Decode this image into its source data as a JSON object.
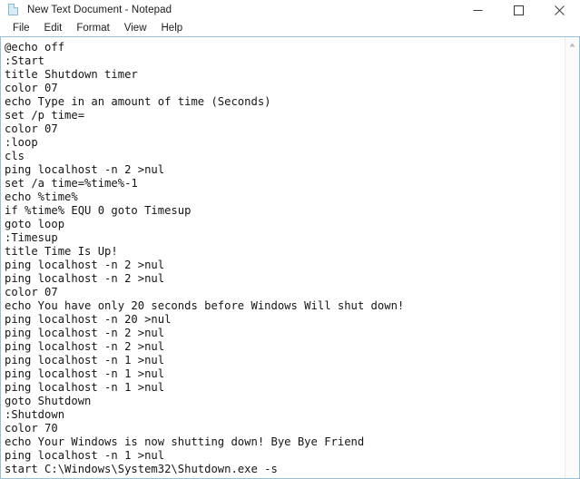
{
  "window": {
    "title": "New Text Document - Notepad",
    "icon": "notepad-document-icon",
    "border_color": "#9bbfd0",
    "titlebar_bg": "#ffffff",
    "text_color": "#151515"
  },
  "window_controls": {
    "minimize": "minimize-icon",
    "maximize": "maximize-icon",
    "close": "close-icon"
  },
  "menubar": {
    "items": [
      {
        "label": "File"
      },
      {
        "label": "Edit"
      },
      {
        "label": "Format"
      },
      {
        "label": "View"
      },
      {
        "label": "Help"
      }
    ]
  },
  "editor": {
    "lines": [
      "@echo off",
      ":Start",
      "title Shutdown timer",
      "color 07",
      "echo Type in an amount of time (Seconds)",
      "set /p time=",
      "color 07",
      ":loop",
      "cls",
      "ping localhost -n 2 >nul",
      "set /a time=%time%-1",
      "echo %time%",
      "if %time% EQU 0 goto Timesup",
      "goto loop",
      ":Timesup",
      "title Time Is Up!",
      "ping localhost -n 2 >nul",
      "ping localhost -n 2 >nul",
      "color 07",
      "echo You have only 20 seconds before Windows Will shut down!",
      "ping localhost -n 20 >nul",
      "ping localhost -n 2 >nul",
      "ping localhost -n 2 >nul",
      "ping localhost -n 1 >nul",
      "ping localhost -n 1 >nul",
      "ping localhost -n 1 >nul",
      "goto Shutdown",
      ":Shutdown",
      "color 70",
      "echo Your Windows is now shutting down! Bye Bye Friend",
      "ping localhost -n 1 >nul",
      "start C:\\Windows\\System32\\Shutdown.exe -s"
    ]
  },
  "scrollbar": {
    "up_arrow": "scroll-up-arrow-icon"
  }
}
